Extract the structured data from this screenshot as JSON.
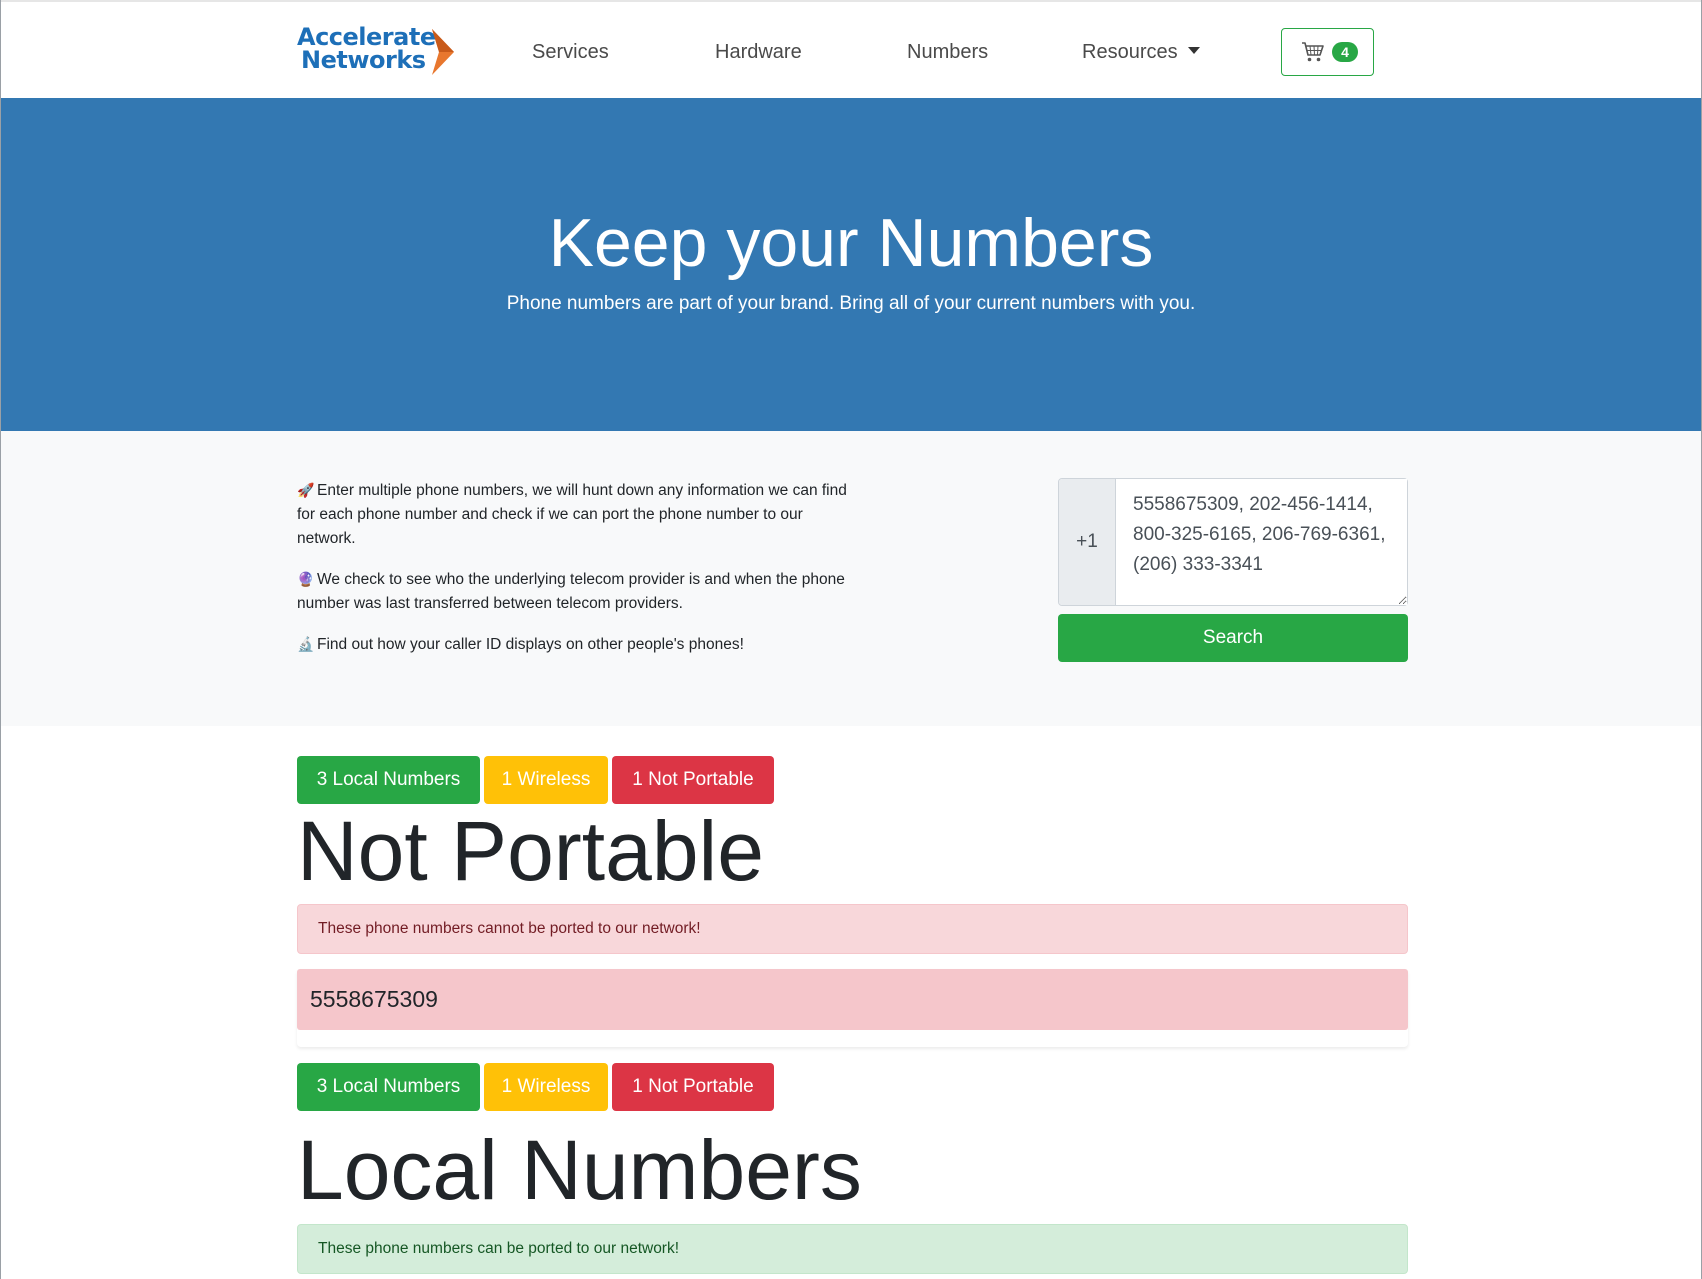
{
  "brand": {
    "line1": "Accelerate",
    "line2": "Networks",
    "colors": {
      "blue": "#1d6fb8",
      "orange": "#e8772e"
    }
  },
  "nav": {
    "services": "Services",
    "hardware": "Hardware",
    "numbers": "Numbers",
    "resources": "Resources",
    "cart_count": "4",
    "cart_icon": "shopping-cart-icon"
  },
  "hero": {
    "title": "Keep your Numbers",
    "subtitle": "Phone numbers are part of your brand. Bring all of your current numbers with you."
  },
  "search": {
    "info": [
      {
        "emoji": "🚀",
        "text": "Enter multiple phone numbers, we will hunt down any information we can find for each phone number and check if we can port the phone number to our network."
      },
      {
        "emoji": "🔮",
        "text": "We check to see who the underlying telecom provider is and when the phone number was last transferred between telecom providers."
      },
      {
        "emoji": "🔬",
        "text": "Find out how your caller ID displays on other people's phones!"
      }
    ],
    "prefix": "+1",
    "input_value": "5558675309, 202-456-1414, 800-325-6165, 206-769-6361, (206) 333-3341",
    "button_label": "Search"
  },
  "filters": {
    "local": "3 Local Numbers",
    "wireless": "1 Wireless",
    "not_portable": "1 Not Portable"
  },
  "sections": {
    "not_portable": {
      "heading": "Not Portable",
      "alert": "These phone numbers cannot be ported to our network!",
      "numbers": [
        "5558675309"
      ]
    },
    "local": {
      "heading": "Local Numbers",
      "alert": "These phone numbers can be ported to our network!"
    }
  },
  "colors": {
    "hero_bg": "#3378b2",
    "success": "#28a745",
    "warning": "#ffc107",
    "danger": "#dc3545",
    "section_bg": "#f8f9fa"
  }
}
